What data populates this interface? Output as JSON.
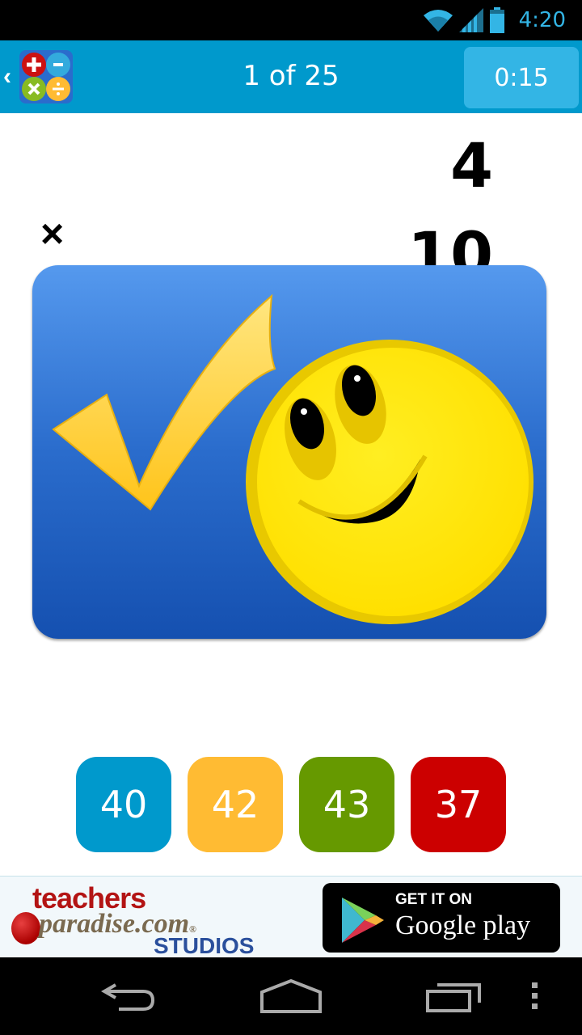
{
  "status_bar": {
    "time": "4:20",
    "icons": [
      "wifi-icon",
      "signal-icon",
      "battery-icon"
    ]
  },
  "app_bar": {
    "back_icon": "chevron-left-icon",
    "logo_icon": "math-operations-logo-icon",
    "progress": "1 of 25",
    "timer": "0:15"
  },
  "problem": {
    "operand_top": "4",
    "operand_bottom": "10",
    "operator": "×"
  },
  "feedback": {
    "type": "correct",
    "icons": [
      "checkmark-icon",
      "smiley-face-icon"
    ]
  },
  "answers": [
    {
      "label": "40",
      "color": "#0099cc"
    },
    {
      "label": "42",
      "color": "#ffbb33"
    },
    {
      "label": "43",
      "color": "#669900"
    },
    {
      "label": "37",
      "color": "#cc0000"
    }
  ],
  "ad": {
    "brand_line1": "teachers",
    "brand_line2": "paradise.com",
    "brand_registered": "®",
    "brand_line3": "STUDIOS",
    "badge_top": "GET IT ON",
    "badge_bottom": "Google play"
  },
  "nav_bar": {
    "buttons": [
      "back-icon",
      "home-icon",
      "recent-apps-icon",
      "overflow-menu-icon"
    ]
  }
}
